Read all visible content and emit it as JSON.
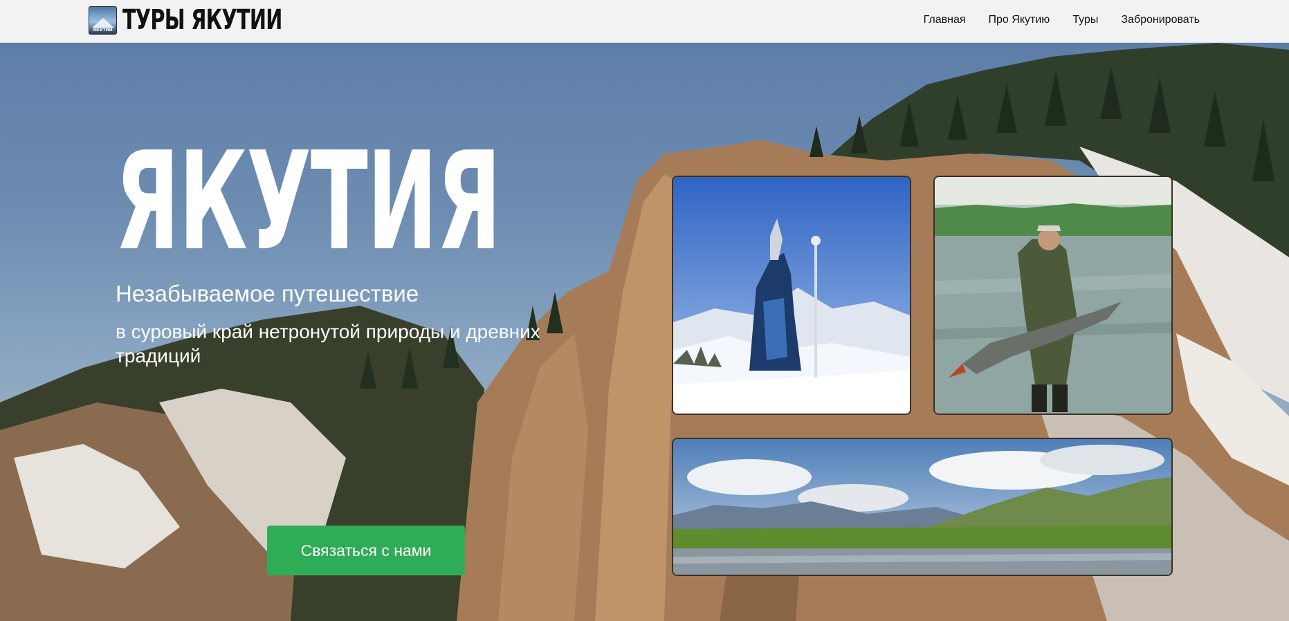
{
  "header": {
    "logo_label": "ЯКУТИИ",
    "brand": "ТУРЫ ЯКУТИИ",
    "nav": [
      {
        "label": "Главная"
      },
      {
        "label": "Про Якутию"
      },
      {
        "label": "Туры"
      },
      {
        "label": "Забронировать"
      }
    ]
  },
  "hero": {
    "title": "ЯКУТИЯ",
    "subtitle_line1": "Незабываемое путешествие",
    "subtitle_line2": "в суровый край нетронутой природы и древних традиций",
    "cta_label": "Связаться с нами"
  },
  "colors": {
    "cta": "#2fac56",
    "header_bg": "#f2f2f2",
    "hero_text": "#ffffff"
  }
}
